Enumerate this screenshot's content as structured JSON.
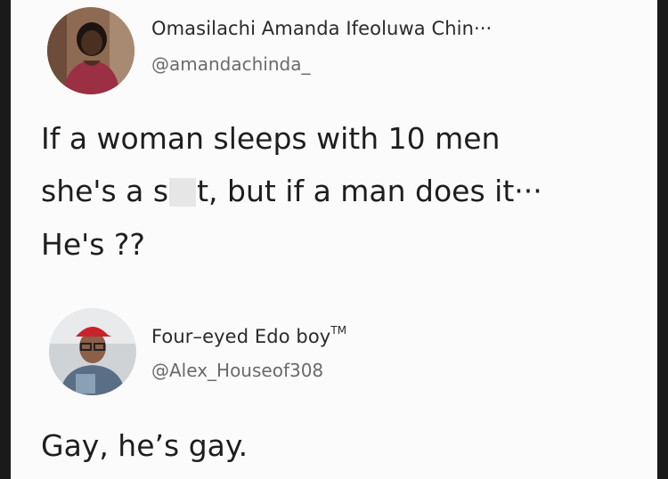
{
  "tweet1": {
    "display_name": "Omasilachi Amanda Ifeoluwa Chin···",
    "handle": "@amandachinda_",
    "line1": "If a woman sleeps with 10 men",
    "line2_a": "she's a s",
    "line2_b": "t, but if a man does it···",
    "line3": "He's ??",
    "avatar_icon": "profile-photo-woman"
  },
  "tweet2": {
    "display_name": "Four–eyed Edo boy",
    "trademark": "TM",
    "handle": "@Alex_Houseof308",
    "text": "Gay, he’s gay.",
    "avatar_icon": "profile-photo-man-red-cap"
  },
  "colors": {
    "card_background": "#fbfbfb",
    "outer_background": "#1a1a1a",
    "name_text": "#2a2a2a",
    "handle_text": "#6a6a6a",
    "body_text": "#1e1e1e"
  }
}
